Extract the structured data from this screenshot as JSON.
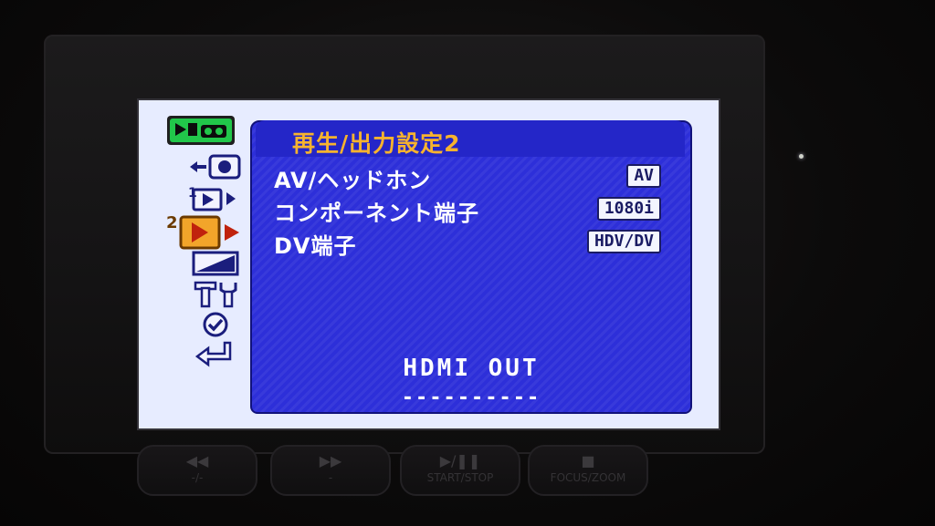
{
  "menu": {
    "title": "再生/出力設定2",
    "items": [
      {
        "label": "AV/ヘッドホン",
        "value": "AV"
      },
      {
        "label": "コンポーネント端子",
        "value": "1080i"
      },
      {
        "label": "DV端子",
        "value": "HDV/DV"
      }
    ],
    "footer": {
      "label": "HDMI OUT",
      "value": "----------"
    },
    "sidebar_icons": [
      {
        "name": "playback-tape-icon",
        "active": false
      },
      {
        "name": "record-icon",
        "active": false
      },
      {
        "name": "playback-settings-1-icon",
        "active": false
      },
      {
        "name": "playback-settings-2-icon",
        "active": true
      },
      {
        "name": "display-icon",
        "active": false
      },
      {
        "name": "tools-icon",
        "active": false
      },
      {
        "name": "check-icon",
        "active": false
      },
      {
        "name": "return-icon",
        "active": false
      }
    ]
  },
  "hardware_buttons": [
    {
      "glyph": "◀◀",
      "label": "-/-"
    },
    {
      "glyph": "▶▶",
      "label": "-"
    },
    {
      "glyph": "▶/❚❚",
      "label": "START/STOP"
    },
    {
      "glyph": "■",
      "label": "FOCUS/ZOOM"
    }
  ],
  "colors": {
    "panel_blue": "#2d2fd9",
    "title_orange": "#f7b32e",
    "active_orange": "#f2a52a",
    "screen_background": "#e7ecff"
  }
}
